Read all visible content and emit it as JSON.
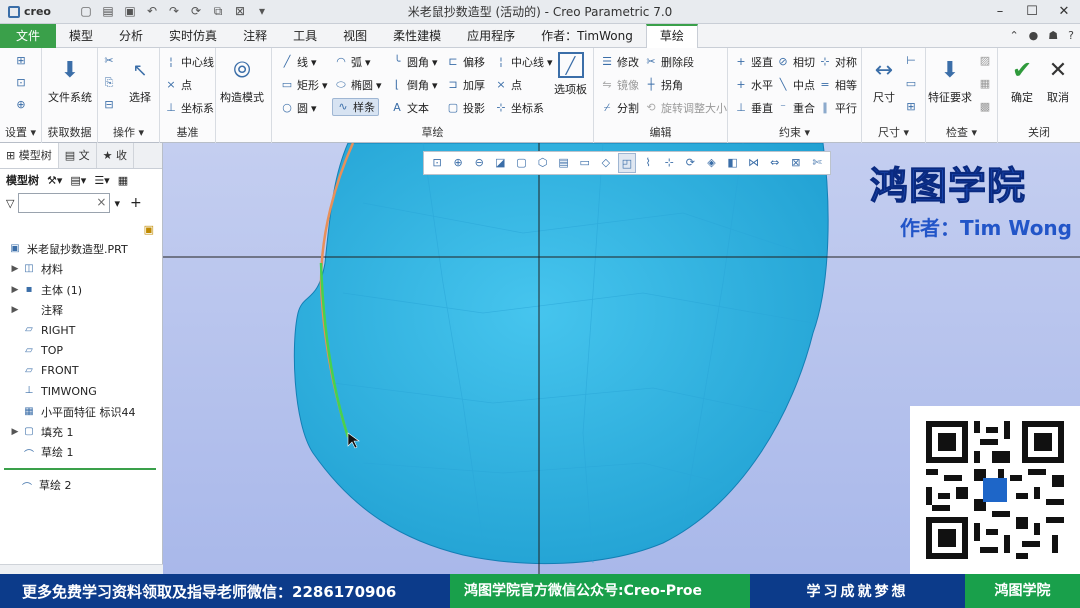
{
  "app": {
    "logo": "creo",
    "title": "米老鼠抄数造型 (活动的) - Creo Parametric 7.0"
  },
  "menubar": {
    "file": "文件",
    "tabs": [
      "模型",
      "分析",
      "实时仿真",
      "注释",
      "工具",
      "视图",
      "柔性建模",
      "应用程序",
      "作者：TimWong",
      "草绘"
    ],
    "active": "草绘"
  },
  "ribbon": {
    "setup": {
      "label": "设置",
      "items": [
        "设置"
      ]
    },
    "getdata": {
      "label": "获取数据",
      "big": "文件系统"
    },
    "ops": {
      "label": "操作",
      "big": "选择"
    },
    "datum": {
      "label": "基准",
      "items": [
        "中心线",
        "点",
        "坐标系"
      ]
    },
    "construct": {
      "big": "构造模式"
    },
    "sketch": {
      "label": "草绘",
      "col1": [
        "线",
        "矩形",
        "圆"
      ],
      "col2": [
        "弧",
        "椭圆",
        "样条"
      ],
      "col3": [
        "圆角",
        "倒角",
        "文本"
      ],
      "col4": [
        "偏移",
        "加厚",
        "投影"
      ],
      "col5": [
        "中心线",
        "点",
        "坐标系"
      ],
      "palette": "选项板"
    },
    "edit": {
      "label": "编辑",
      "items": [
        "修改",
        "删除段",
        "镜像",
        "拐角",
        "分割",
        "旋转调整大小"
      ]
    },
    "constraint": {
      "label": "约束",
      "items": [
        "竖直",
        "相切",
        "对称",
        "水平",
        "中点",
        "相等",
        "垂直",
        "重合",
        "平行"
      ]
    },
    "dim": {
      "label": "尺寸",
      "big": "尺寸"
    },
    "inspect": {
      "label": "检查",
      "big": "特征要求"
    },
    "close": {
      "label": "关闭",
      "ok": "确定",
      "cancel": "取消"
    }
  },
  "sidebar": {
    "tabs": [
      "模型树",
      "文",
      "收"
    ],
    "tree_label": "模型树",
    "items": [
      {
        "label": "米老鼠抄数造型.PRT",
        "icon": "part-icon",
        "expand": false,
        "indent": 0
      },
      {
        "label": "材料",
        "icon": "material-icon",
        "expand": true,
        "indent": 1
      },
      {
        "label": "主体 (1)",
        "icon": "body-icon",
        "expand": true,
        "indent": 1
      },
      {
        "label": "注释",
        "icon": "annotation-icon",
        "expand": true,
        "indent": 1
      },
      {
        "label": "RIGHT",
        "icon": "plane-icon",
        "expand": false,
        "indent": 1
      },
      {
        "label": "TOP",
        "icon": "plane-icon",
        "expand": false,
        "indent": 1
      },
      {
        "label": "FRONT",
        "icon": "plane-icon",
        "expand": false,
        "indent": 1
      },
      {
        "label": "TIMWONG",
        "icon": "csys-icon",
        "expand": false,
        "indent": 1
      },
      {
        "label": "小平面特征 标识44",
        "icon": "facet-icon",
        "expand": false,
        "indent": 1
      },
      {
        "label": "填充 1",
        "icon": "fill-icon",
        "expand": true,
        "indent": 1
      },
      {
        "label": "草绘 1",
        "icon": "sketch-icon",
        "expand": false,
        "indent": 1
      }
    ],
    "insert_item": "草绘 2"
  },
  "brand": {
    "title": "鸿图学院",
    "author": "作者：Tim Wong"
  },
  "footer": {
    "left": "更多免费学习资料领取及指导老师微信：2286170906",
    "mid": "鸿图学院官方微信公众号:Creo-Proe",
    "slogan": "学习成就梦想",
    "right": "鸿图学院"
  },
  "colors": {
    "accent": "#3aa04a",
    "model": "#3cb8e6",
    "canvas": "#b5c2ee",
    "footer": "#0c3b8a"
  }
}
